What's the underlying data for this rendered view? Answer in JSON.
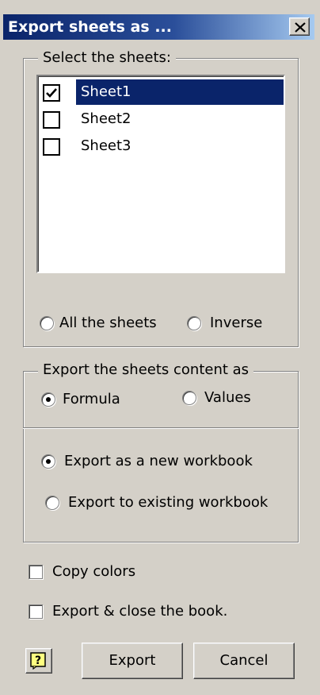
{
  "window": {
    "title": "Export sheets as ...",
    "close_glyph": "✕"
  },
  "select_group": {
    "legend": "Select the sheets:",
    "sheets": [
      {
        "label": "Sheet1",
        "checked": true,
        "selected": true
      },
      {
        "label": "Sheet2",
        "checked": false,
        "selected": false
      },
      {
        "label": "Sheet3",
        "checked": false,
        "selected": false
      }
    ],
    "all_sheets_label": "All the sheets",
    "inverse_label": "Inverse"
  },
  "content_group": {
    "legend": "Export the sheets content as",
    "formula_label": "Formula",
    "values_label": "Values",
    "selected": "Formula"
  },
  "destination": {
    "new_workbook_label": "Export  as a new workbook",
    "existing_workbook_label": "Export to existing workbook",
    "selected": "new"
  },
  "options": {
    "copy_colors_label": "Copy colors",
    "export_close_label": "Export & close the book."
  },
  "buttons": {
    "help_glyph": "?",
    "export_label": "Export",
    "cancel_label": "Cancel"
  },
  "colors": {
    "title_start": "#0a246a",
    "title_end": "#a6caf0",
    "selection": "#0a246a",
    "face": "#d4d0c8"
  }
}
